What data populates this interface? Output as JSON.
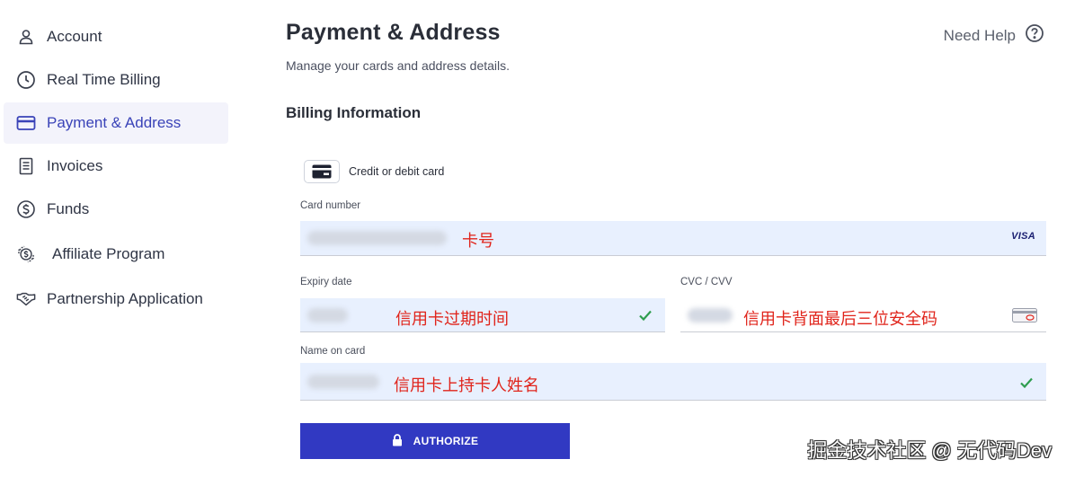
{
  "sidebar": {
    "items": [
      {
        "label": "Account",
        "icon": "user-icon"
      },
      {
        "label": "Real Time Billing",
        "icon": "clock-icon"
      },
      {
        "label": "Payment & Address",
        "icon": "credit-card-icon",
        "active": true
      },
      {
        "label": "Invoices",
        "icon": "invoice-icon"
      },
      {
        "label": "Funds",
        "icon": "dollar-circle-icon"
      },
      {
        "label": "Affiliate Program",
        "icon": "affiliate-dollar-icon"
      },
      {
        "label": "Partnership Application",
        "icon": "handshake-icon"
      }
    ]
  },
  "header": {
    "title": "Payment & Address",
    "subtitle": "Manage your cards and address details.",
    "help_label": "Need Help"
  },
  "billing": {
    "section_title": "Billing Information",
    "method_label": "Credit or debit card",
    "card_number": {
      "label": "Card number",
      "annotation": "卡号",
      "brand": "VISA"
    },
    "expiry": {
      "label": "Expiry date",
      "annotation": "信用卡过期时间"
    },
    "cvc": {
      "label": "CVC / CVV",
      "annotation": "信用卡背面最后三位安全码"
    },
    "name": {
      "label": "Name on card",
      "annotation": "信用卡上持卡人姓名"
    },
    "authorize_label": "AUTHORIZE"
  },
  "watermark": "掘金技术社区 @ 无代码Dev",
  "colors": {
    "accent": "#3139c2",
    "active_bg": "#f3f3fb",
    "field_bg": "#e8f0fe",
    "annotation": "#e0241b",
    "check": "#2e9d4f"
  }
}
